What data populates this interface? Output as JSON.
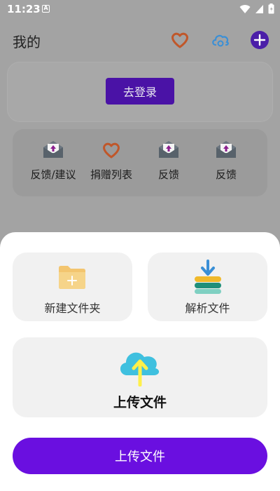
{
  "status_bar": {
    "time": "11:23",
    "notification_glyph": "A",
    "icons": [
      "wifi-icon",
      "signal-icon",
      "battery-icon"
    ]
  },
  "header": {
    "title": "我的",
    "icons": [
      "heart-icon",
      "cloud-sync-icon",
      "add-icon"
    ]
  },
  "login": {
    "button_label": "去登录"
  },
  "shortcuts": [
    {
      "label": "反馈/建议",
      "icon": "feedback-envelope-icon"
    },
    {
      "label": "捐赠列表",
      "icon": "donate-heart-icon"
    },
    {
      "label": "反馈",
      "icon": "feedback-envelope-icon"
    },
    {
      "label": "反馈",
      "icon": "feedback-envelope-icon"
    }
  ],
  "sheet": {
    "new_folder_label": "新建文件夹",
    "parse_file_label": "解析文件",
    "upload_tile_label": "上传文件",
    "cta_label": "上传文件"
  },
  "colors": {
    "accent": "#6a0fe0",
    "login_button": "#4a12a6",
    "heart": "#c0572a",
    "cloud": "#3a8fd6",
    "folder": "#f3c56f",
    "upload_arrow": "#fff04a",
    "cloud_fill": "#3fc0df"
  }
}
